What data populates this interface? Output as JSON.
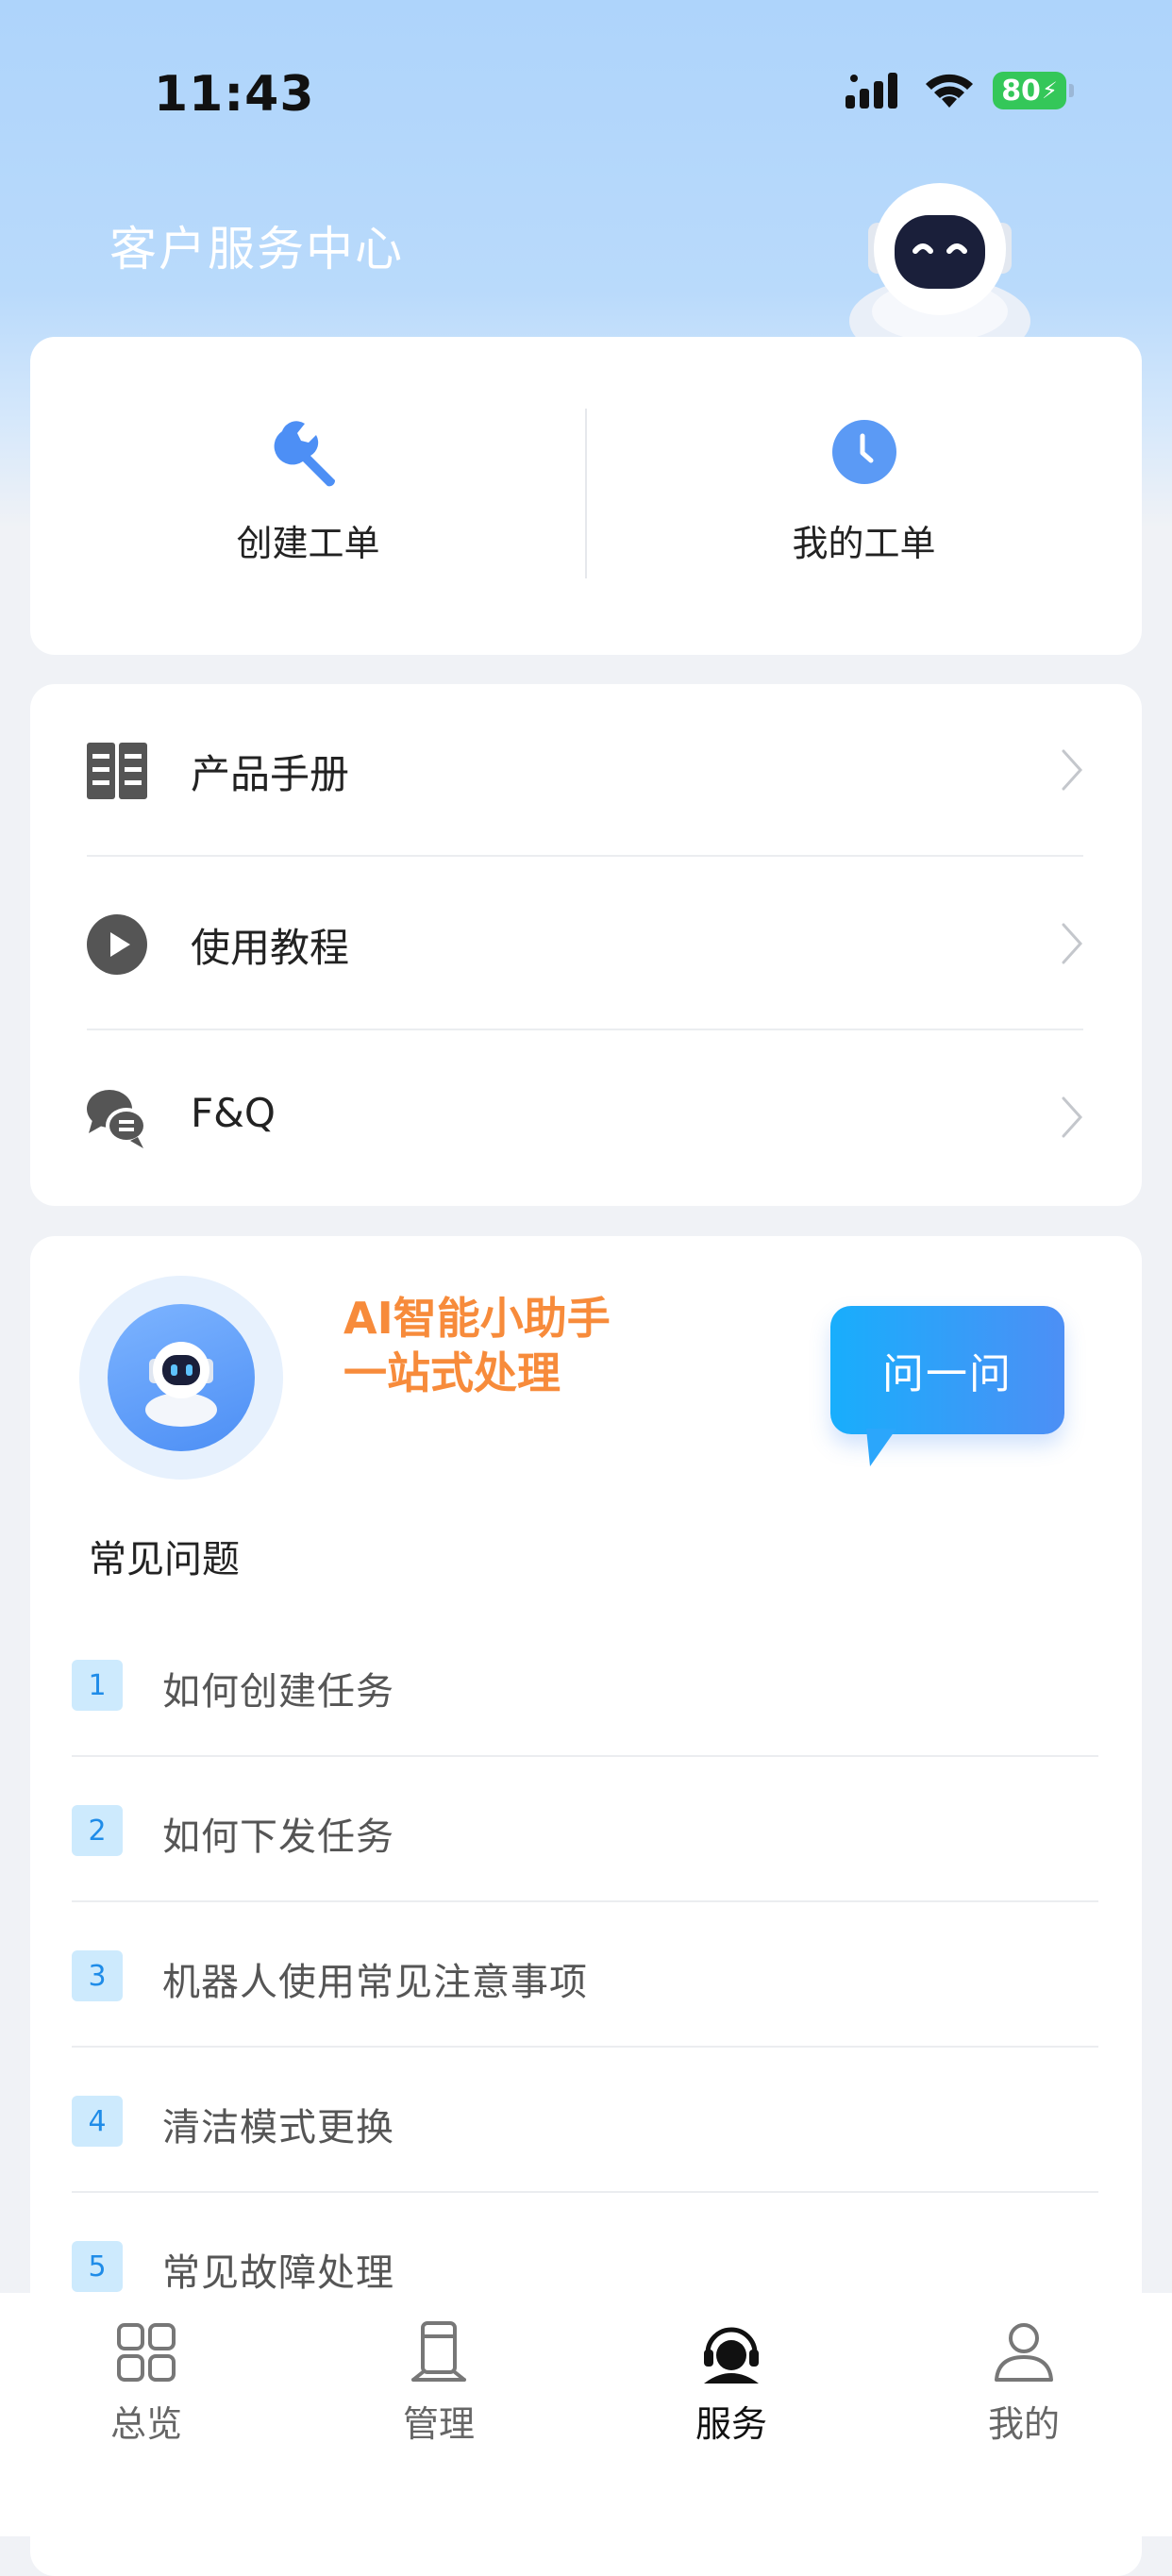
{
  "status_bar": {
    "time": "11:43",
    "battery": "80"
  },
  "header": {
    "title": "客户服务中心"
  },
  "quick_actions": [
    {
      "label": "创建工单",
      "icon": "wrench-icon"
    },
    {
      "label": "我的工单",
      "icon": "clock-icon"
    }
  ],
  "menu": [
    {
      "label": "产品手册",
      "icon": "book-icon"
    },
    {
      "label": "使用教程",
      "icon": "play-icon"
    },
    {
      "label": "F&Q",
      "icon": "chat-bubbles-icon"
    }
  ],
  "assistant": {
    "title_line1": "AI智能小助手",
    "title_line2": "一站式处理",
    "ask_label": "问一问"
  },
  "faq": {
    "title": "常见问题",
    "items": [
      {
        "num": "1",
        "text": "如何创建任务"
      },
      {
        "num": "2",
        "text": "如何下发任务"
      },
      {
        "num": "3",
        "text": "机器人使用常见注意事项"
      },
      {
        "num": "4",
        "text": "清洁模式更换"
      },
      {
        "num": "5",
        "text": "常见故障处理"
      }
    ]
  },
  "tabbar": {
    "active": "服务",
    "items": [
      {
        "label": "总览",
        "icon": "grid-icon"
      },
      {
        "label": "管理",
        "icon": "device-icon"
      },
      {
        "label": "服务",
        "icon": "headset-icon"
      },
      {
        "label": "我的",
        "icon": "person-icon"
      }
    ]
  },
  "colors": {
    "accent": "#4d8ff5",
    "orange_title": "#f78b3b",
    "battery_green": "#34c759",
    "badge_bg": "#cdeafd"
  }
}
